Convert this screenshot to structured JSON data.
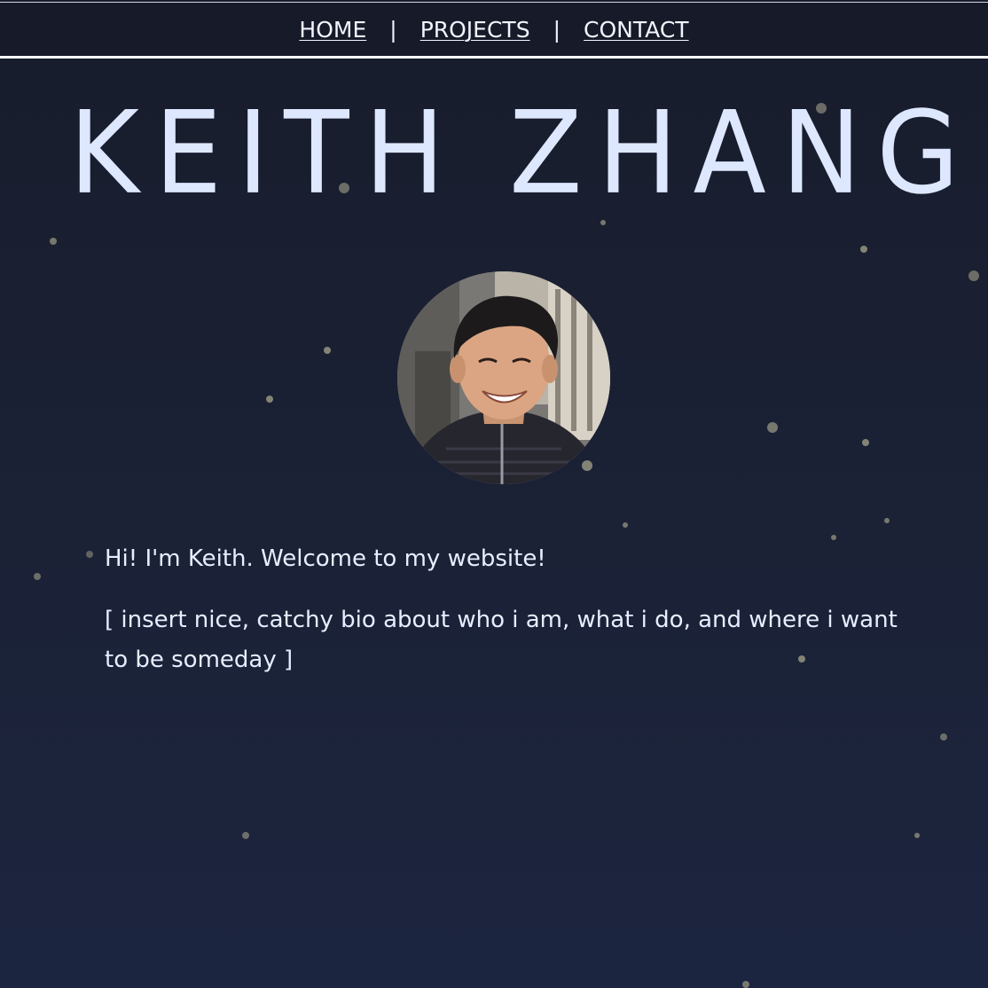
{
  "nav": {
    "items": [
      {
        "label": "HOME"
      },
      {
        "label": "PROJECTS"
      },
      {
        "label": "CONTACT"
      }
    ],
    "separator": "|"
  },
  "hero": {
    "title": "KEITH ZHANG"
  },
  "bio": {
    "greeting": "Hi! I'm Keith. Welcome to my website!",
    "text": "[ insert nice, catchy bio about who i am, what i do, and where i want to be someday ]"
  },
  "colors": {
    "background_top": "#181c2c",
    "background_bottom": "#1c2540",
    "title": "#dde8ff",
    "text": "#e6eeff",
    "star": "#8f8f7d"
  }
}
